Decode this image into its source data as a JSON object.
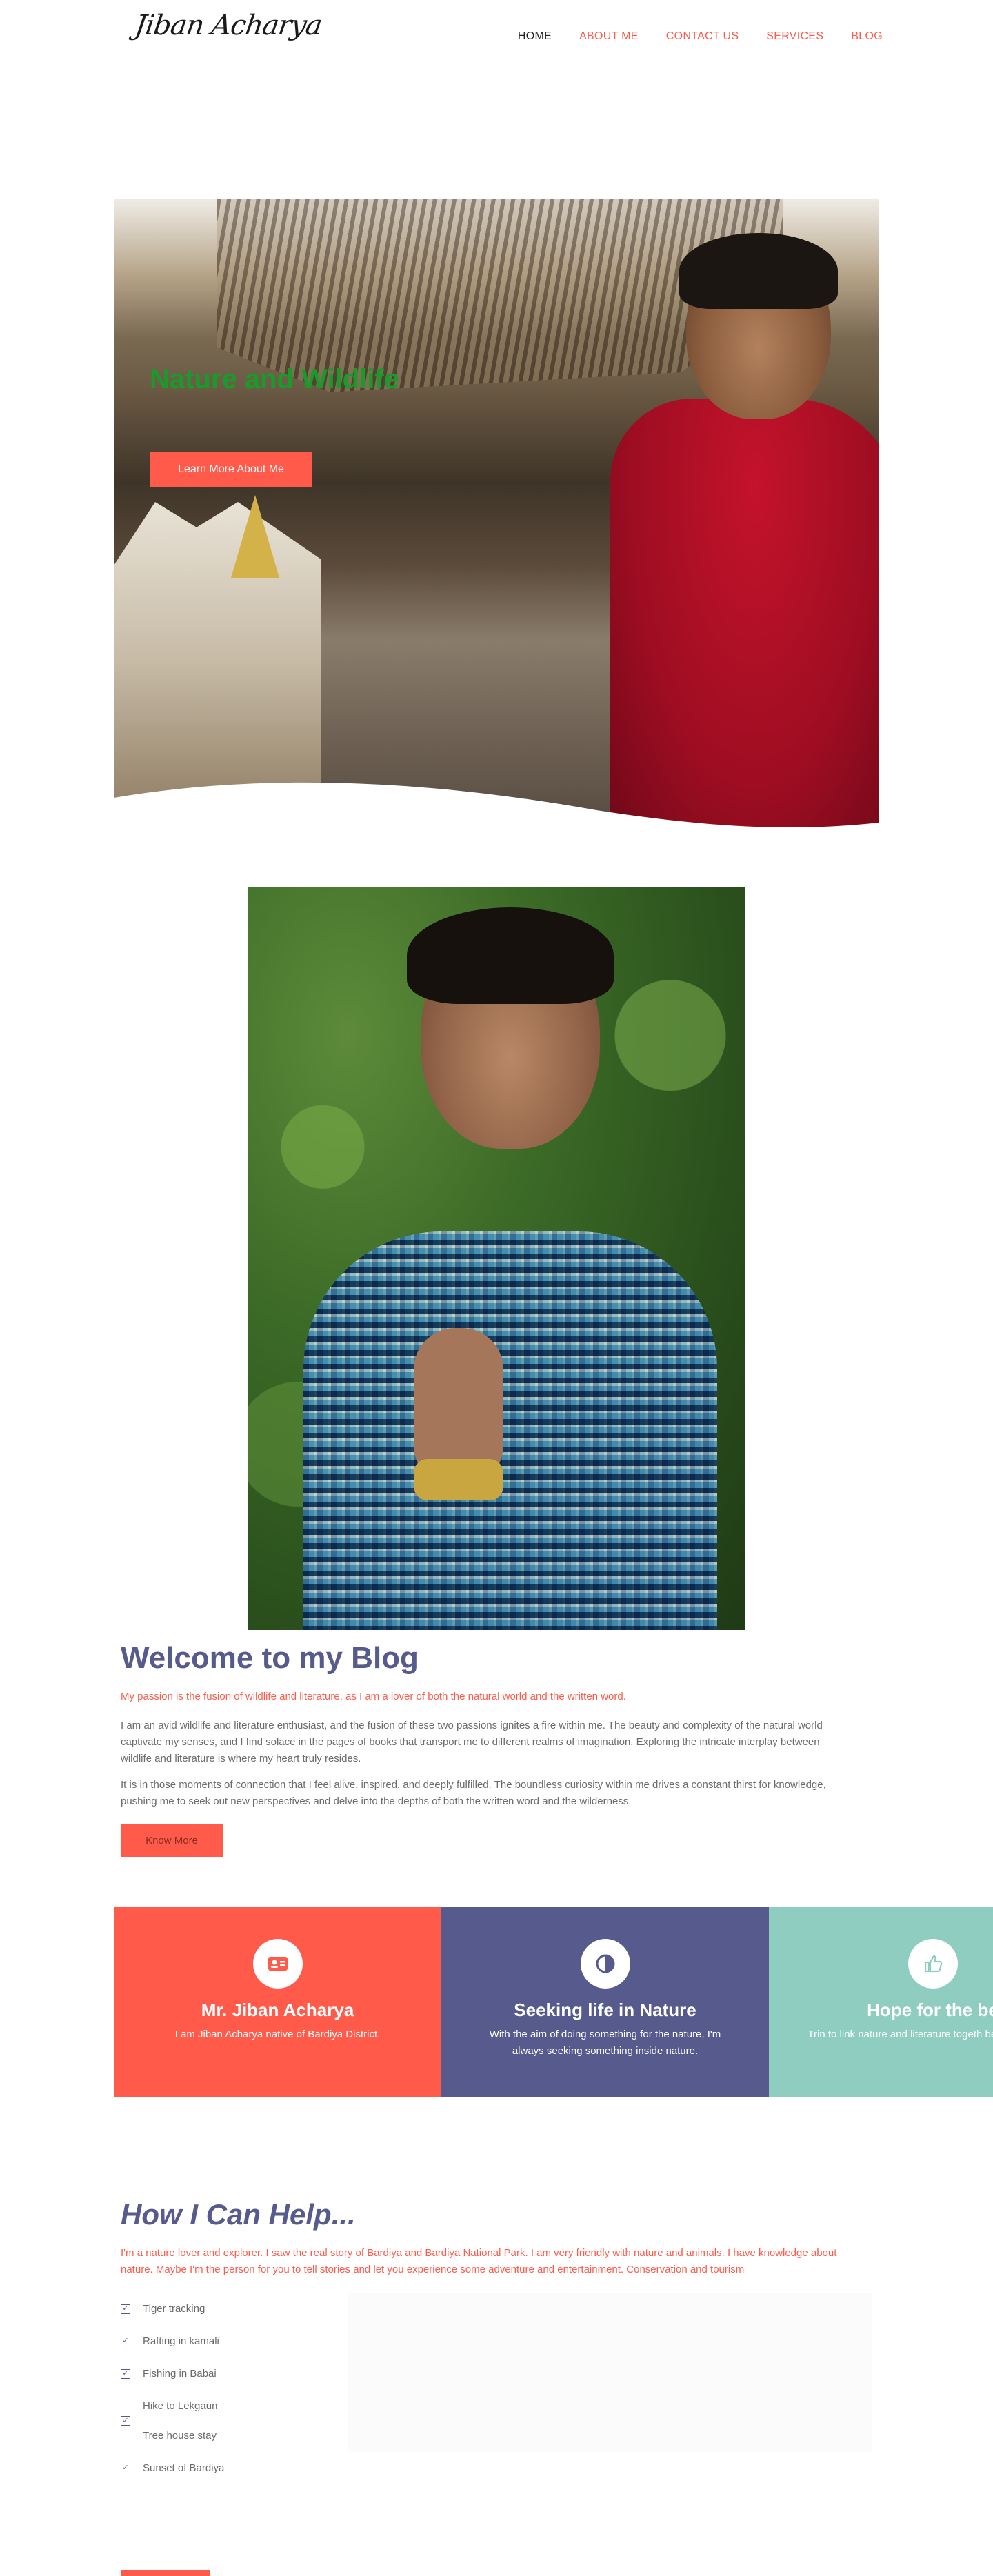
{
  "header": {
    "logo_text": "Jiban Acharya",
    "nav": [
      {
        "label": "HOME",
        "active": true
      },
      {
        "label": "ABOUT ME",
        "active": false
      },
      {
        "label": "CONTACT US",
        "active": false
      },
      {
        "label": "SERVICES",
        "active": false
      },
      {
        "label": "BLOG",
        "active": false
      }
    ]
  },
  "hero": {
    "title": "Nature and Wildlife",
    "button_label": "Learn More About Me"
  },
  "welcome": {
    "title": "Welcome to my Blog",
    "lead": "My passion is the fusion of wildlife and literature, as I am a lover of both the natural world and the written word.",
    "paragraph1": "I am an avid wildlife and literature enthusiast, and the fusion of these two passions ignites a fire within me. The beauty and complexity of the natural world captivate my senses, and I find solace in the pages of books that transport me to different realms of imagination. Exploring the intricate interplay between wildlife and literature is where my heart truly resides.",
    "paragraph2": "It is in those moments of connection that I feel alive, inspired, and deeply fulfilled. The boundless curiosity within me drives a constant thirst for knowledge, pushing me to seek out new perspectives and delve into the depths of both the written word and the wilderness.",
    "button_label": "Know More"
  },
  "features": [
    {
      "title": "Mr. Jiban Acharya",
      "text": "I am Jiban Acharya native of Bardiya District.",
      "icon": "id-card-icon",
      "color": "#ff5a4a"
    },
    {
      "title": "Seeking life in Nature",
      "text": "With the aim of doing something for the nature, I'm always seeking something inside nature.",
      "icon": "contrast-icon",
      "color": "#565a8c"
    },
    {
      "title": "Hope for the be",
      "text": "Trin to link nature and literature togeth beautiful fusion.",
      "icon": "thumbs-up-icon",
      "color": "#8fcdc0"
    }
  ],
  "help": {
    "title": "How I Can Help...",
    "intro": "I'm a nature lover and explorer. I saw the real story of Bardiya and Bardiya National Park. I am very friendly with nature and animals. I have knowledge about nature. Maybe I'm the person for you to tell stories and let you experience some adventure and entertainment. Conservation and tourism",
    "items": [
      {
        "label": "Tiger tracking"
      },
      {
        "label": "Rafting in kamali"
      },
      {
        "label": "Fishing in Babai"
      },
      {
        "lines": [
          "Hike to Lekgaun",
          "Tree house stay"
        ]
      },
      {
        "label": "Sunset of Bardiya"
      }
    ]
  },
  "colors": {
    "accent": "#ff5a4a",
    "navy": "#565a8c",
    "teal": "#8fcdc0",
    "hero_title": "#1a9a2a"
  }
}
